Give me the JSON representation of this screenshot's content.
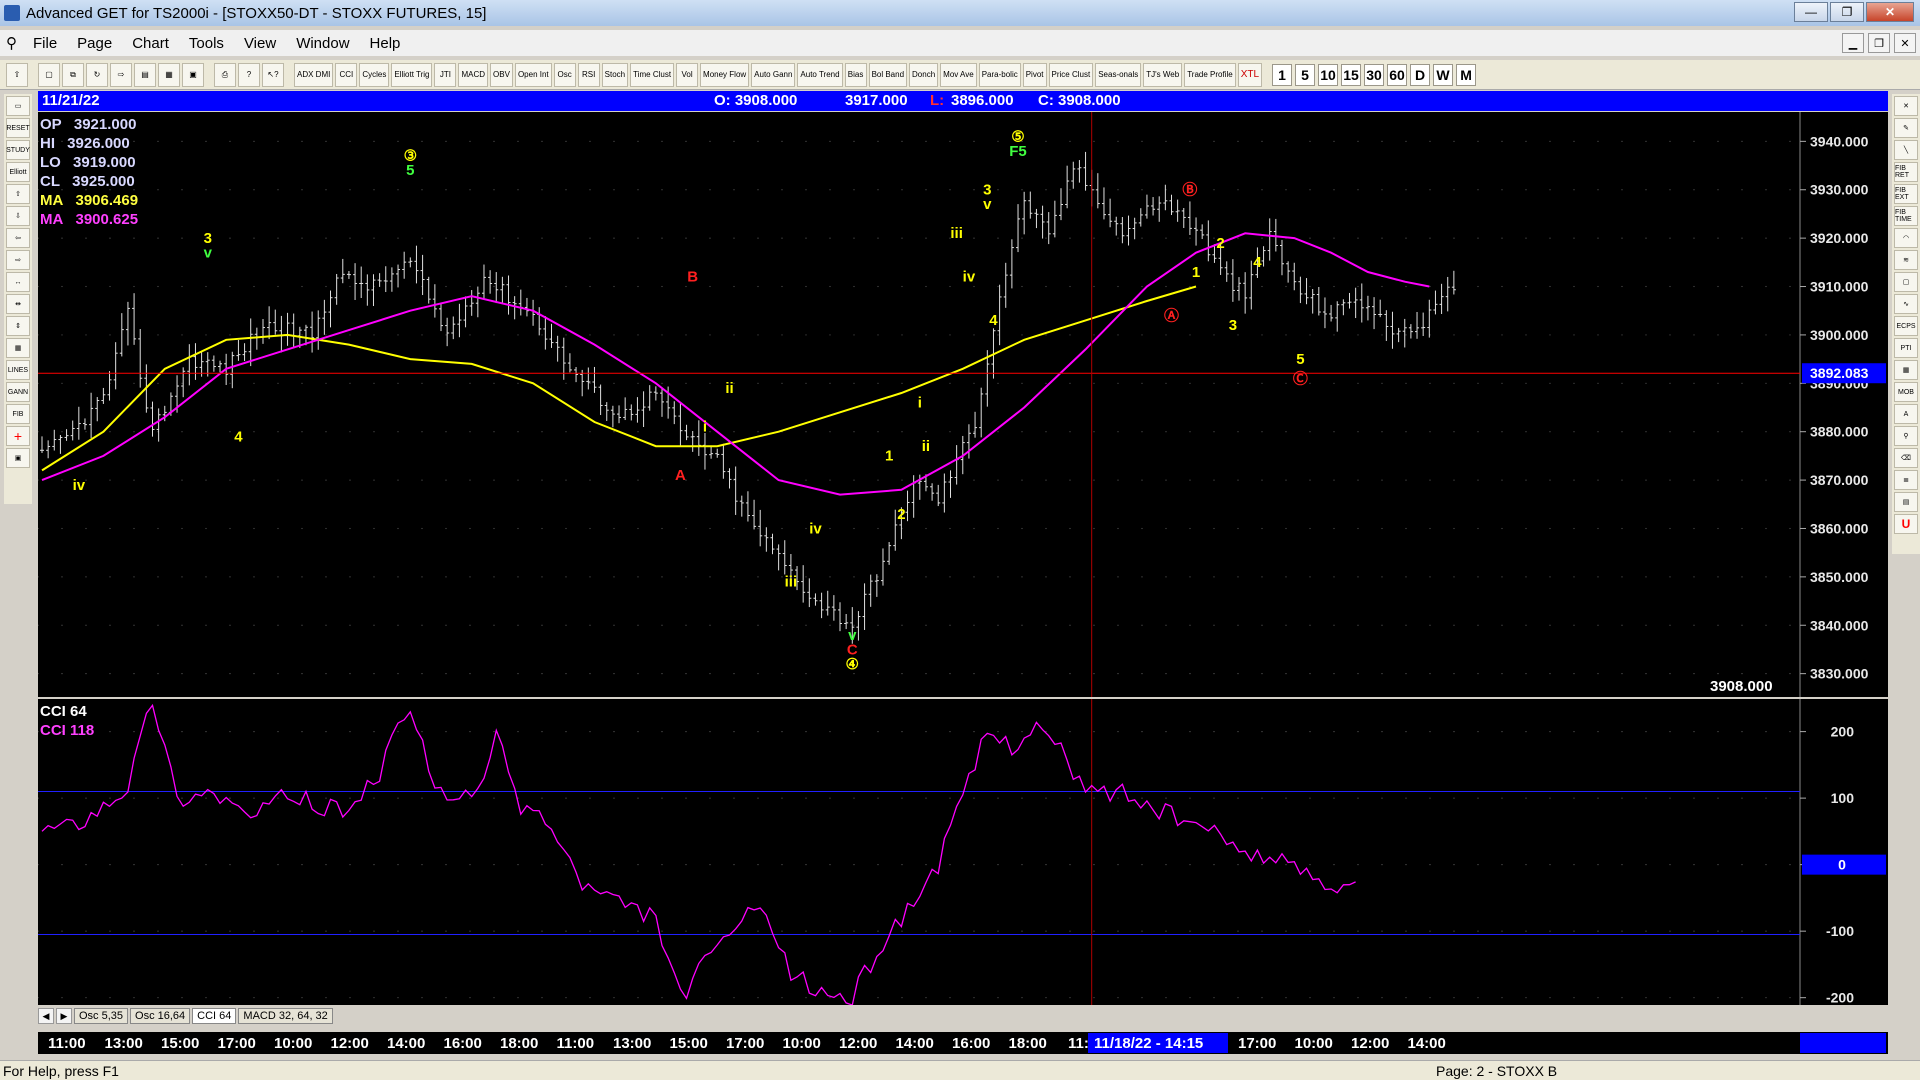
{
  "window": {
    "title": "Advanced GET for TS2000i - [STOXX50-DT - STOXX FUTURES, 15]",
    "minimize_glyph": "—",
    "maximize_glyph": "❐",
    "close_glyph": "✕"
  },
  "menu": [
    "File",
    "Page",
    "Chart",
    "Tools",
    "View",
    "Window",
    "Help"
  ],
  "doc_buttons": [
    "▁",
    "❐",
    "✕"
  ],
  "toolbar": {
    "studies": [
      "ADX DMI",
      "CCI",
      "Cycles",
      "Elliott Trig",
      "JTI",
      "MACD",
      "OBV",
      "Open Int",
      "Osc",
      "RSI",
      "Stoch",
      "Time Clust",
      "Vol",
      "Money Flow",
      "Auto Gann",
      "Auto Trend",
      "Bias",
      "Bol Band",
      "Donch",
      "Mov Ave",
      "Para-bolic",
      "Pivot",
      "Price Clust",
      "Seas-onals",
      "TJ's Web",
      "Trade Profile",
      "XTL"
    ],
    "periods": [
      "1",
      "5",
      "10",
      "15",
      "30",
      "60",
      "D",
      "W",
      "M"
    ]
  },
  "left_tools": [
    "RESET",
    "STUDY",
    "Elliott",
    "LINES",
    "GANN",
    "FIB"
  ],
  "right_tools": [
    "FIB RET",
    "FIB EXT",
    "FIB TIME",
    "ECPS",
    "PTI",
    "MOB"
  ],
  "infobar": {
    "date": "11/21/22",
    "open": "O: 3908.000",
    "high": "3917.000",
    "low_label": "L:",
    "low": "3896.000",
    "close": "C: 3908.000"
  },
  "readouts": [
    {
      "label": "OP",
      "value": "3921.000",
      "color": "#d8d8ff"
    },
    {
      "label": "HI",
      "value": "3926.000",
      "color": "#d8d8ff"
    },
    {
      "label": "LO",
      "value": "3919.000",
      "color": "#d8d8ff"
    },
    {
      "label": "CL",
      "value": "3925.000",
      "color": "#d8d8ff"
    },
    {
      "label": "MA",
      "value": "3906.469",
      "color": "#ffff40"
    },
    {
      "label": "MA",
      "value": "3900.625",
      "color": "#ff40ff"
    }
  ],
  "cci_readouts": [
    {
      "label": "CCI 64",
      "value": "",
      "color": "#ffffff"
    },
    {
      "label": "CCI",
      "value": "118",
      "color": "#ff40ff"
    }
  ],
  "price_cursor_label": "3892.083",
  "last_price_label": "3908.000",
  "cci_zero_label": "0",
  "time_cursor_label": "11/18/22 - 14:15",
  "tabs": [
    "Osc 5,35",
    "Osc 16,64",
    "CCI 64",
    "MACD 32, 64, 32"
  ],
  "active_tab": "CCI 64",
  "status": {
    "left": "For Help, press F1",
    "right": "Page: 2 - STOXX B"
  },
  "colors": {
    "bars": "#e0e0e0",
    "ma_fast": "#ffff00",
    "ma_slow": "#ff00ff",
    "cursor": "#ff0000",
    "wave_yellow": "#ffff00",
    "wave_red": "#ff2020",
    "wave_green": "#40ff40",
    "cci_band": "#2020ff"
  },
  "chart_data": [
    {
      "type": "candlestick",
      "title": "STOXX50-DT - STOXX FUTURES, 15",
      "ylim": [
        3826,
        3944
      ],
      "y_ticks": [
        3830,
        3840,
        3850,
        3860,
        3870,
        3880,
        3890,
        3900,
        3910,
        3920,
        3930,
        3940
      ],
      "y_tick_labels": [
        "3830.000",
        "3840.000",
        "3850.000",
        "3860.000",
        "3870.000",
        "3880.000",
        "3890.000",
        "3900.000",
        "3910.000",
        "3920.000",
        "3930.000",
        "3940.000"
      ],
      "x_labels": [
        "11:00",
        "13:00",
        "15:00",
        "17:00",
        "10:00",
        "12:00",
        "14:00",
        "16:00",
        "18:00",
        "11:00",
        "13:00",
        "15:00",
        "17:00",
        "10:00",
        "12:00",
        "14:00",
        "16:00",
        "18:00",
        "11:",
        "17:00",
        "10:00",
        "12:00",
        "14:00"
      ],
      "price_path": [
        [
          0,
          3875
        ],
        [
          5,
          3880
        ],
        [
          10,
          3887
        ],
        [
          14,
          3904
        ],
        [
          18,
          3880
        ],
        [
          24,
          3895
        ],
        [
          30,
          3893
        ],
        [
          36,
          3902
        ],
        [
          44,
          3900
        ],
        [
          48,
          3912
        ],
        [
          54,
          3910
        ],
        [
          60,
          3915
        ],
        [
          66,
          3900
        ],
        [
          72,
          3912
        ],
        [
          80,
          3904
        ],
        [
          86,
          3893
        ],
        [
          94,
          3883
        ],
        [
          100,
          3888
        ],
        [
          104,
          3880
        ],
        [
          110,
          3874
        ],
        [
          115,
          3862
        ],
        [
          120,
          3854
        ],
        [
          126,
          3845
        ],
        [
          132,
          3840
        ],
        [
          138,
          3856
        ],
        [
          142,
          3870
        ],
        [
          146,
          3866
        ],
        [
          152,
          3882
        ],
        [
          156,
          3908
        ],
        [
          160,
          3928
        ],
        [
          164,
          3920
        ],
        [
          168,
          3935
        ],
        [
          172,
          3928
        ],
        [
          176,
          3921
        ],
        [
          182,
          3928
        ],
        [
          188,
          3922
        ],
        [
          192,
          3913
        ],
        [
          196,
          3908
        ],
        [
          200,
          3921
        ],
        [
          204,
          3910
        ],
        [
          210,
          3904
        ],
        [
          214,
          3908
        ],
        [
          218,
          3903
        ],
        [
          222,
          3900
        ],
        [
          226,
          3904
        ],
        [
          228,
          3907
        ],
        [
          230,
          3910
        ]
      ],
      "ma_fast": [
        [
          0,
          3872
        ],
        [
          10,
          3880
        ],
        [
          20,
          3893
        ],
        [
          30,
          3899
        ],
        [
          40,
          3900
        ],
        [
          50,
          3898
        ],
        [
          60,
          3895
        ],
        [
          70,
          3894
        ],
        [
          80,
          3890
        ],
        [
          90,
          3882
        ],
        [
          100,
          3877
        ],
        [
          110,
          3877
        ],
        [
          120,
          3880
        ],
        [
          130,
          3884
        ],
        [
          140,
          3888
        ],
        [
          150,
          3893
        ],
        [
          160,
          3899
        ],
        [
          170,
          3903
        ],
        [
          180,
          3907
        ],
        [
          188,
          3910
        ]
      ],
      "ma_slow": [
        [
          0,
          3870
        ],
        [
          10,
          3875
        ],
        [
          20,
          3883
        ],
        [
          30,
          3893
        ],
        [
          40,
          3897
        ],
        [
          50,
          3901
        ],
        [
          60,
          3905
        ],
        [
          70,
          3908
        ],
        [
          80,
          3905
        ],
        [
          90,
          3898
        ],
        [
          100,
          3890
        ],
        [
          110,
          3880
        ],
        [
          120,
          3870
        ],
        [
          130,
          3867
        ],
        [
          140,
          3868
        ],
        [
          150,
          3875
        ],
        [
          160,
          3885
        ],
        [
          170,
          3897
        ],
        [
          180,
          3910
        ],
        [
          188,
          3917
        ],
        [
          196,
          3921
        ],
        [
          204,
          3920
        ],
        [
          210,
          3917
        ],
        [
          216,
          3913
        ],
        [
          222,
          3911
        ],
        [
          226,
          3910
        ]
      ],
      "wave_labels": [
        {
          "text": "iv",
          "i": 6,
          "y": 3868,
          "color": "#ffff00"
        },
        {
          "text": "3",
          "i": 27,
          "y": 3919,
          "color": "#ffff00"
        },
        {
          "text": "v",
          "i": 27,
          "y": 3916,
          "color": "#40ff40"
        },
        {
          "text": "4",
          "i": 32,
          "y": 3878,
          "color": "#ffff00"
        },
        {
          "text": "③",
          "i": 60,
          "y": 3936,
          "color": "#ffff00"
        },
        {
          "text": "5",
          "i": 60,
          "y": 3933,
          "color": "#40ff40"
        },
        {
          "text": "B",
          "i": 106,
          "y": 3911,
          "color": "#ff2020"
        },
        {
          "text": "A",
          "i": 104,
          "y": 3870,
          "color": "#ff2020"
        },
        {
          "text": "ii",
          "i": 112,
          "y": 3888,
          "color": "#ffff00"
        },
        {
          "text": "i",
          "i": 108,
          "y": 3880,
          "color": "#ffff00"
        },
        {
          "text": "iv",
          "i": 126,
          "y": 3859,
          "color": "#ffff00"
        },
        {
          "text": "iii",
          "i": 122,
          "y": 3848,
          "color": "#ffff00"
        },
        {
          "text": "v",
          "i": 132,
          "y": 3837,
          "color": "#40ff40"
        },
        {
          "text": "C",
          "i": 132,
          "y": 3834,
          "color": "#ff2020"
        },
        {
          "text": "④",
          "i": 132,
          "y": 3831,
          "color": "#ffff00"
        },
        {
          "text": "1",
          "i": 138,
          "y": 3874,
          "color": "#ffff00"
        },
        {
          "text": "2",
          "i": 140,
          "y": 3862,
          "color": "#ffff00"
        },
        {
          "text": "i",
          "i": 143,
          "y": 3885,
          "color": "#ffff00"
        },
        {
          "text": "ii",
          "i": 144,
          "y": 3876,
          "color": "#ffff00"
        },
        {
          "text": "iii",
          "i": 149,
          "y": 3920,
          "color": "#ffff00"
        },
        {
          "text": "iv",
          "i": 151,
          "y": 3911,
          "color": "#ffff00"
        },
        {
          "text": "3",
          "i": 154,
          "y": 3929,
          "color": "#ffff00"
        },
        {
          "text": "v",
          "i": 154,
          "y": 3926,
          "color": "#ffff00"
        },
        {
          "text": "4",
          "i": 155,
          "y": 3902,
          "color": "#ffff00"
        },
        {
          "text": "⑤",
          "i": 159,
          "y": 3940,
          "color": "#ffff00"
        },
        {
          "text": "F5",
          "i": 159,
          "y": 3937,
          "color": "#40ff40"
        },
        {
          "text": "Ⓑ",
          "i": 187,
          "y": 3929,
          "color": "#ff2020"
        },
        {
          "text": "1",
          "i": 188,
          "y": 3912,
          "color": "#ffff00"
        },
        {
          "text": "2",
          "i": 192,
          "y": 3918,
          "color": "#ffff00"
        },
        {
          "text": "Ⓐ",
          "i": 184,
          "y": 3903,
          "color": "#ff2020"
        },
        {
          "text": "3",
          "i": 194,
          "y": 3901,
          "color": "#ffff00"
        },
        {
          "text": "4",
          "i": 198,
          "y": 3914,
          "color": "#ffff00"
        },
        {
          "text": "5",
          "i": 205,
          "y": 3894,
          "color": "#ffff00"
        },
        {
          "text": "Ⓒ",
          "i": 205,
          "y": 3890,
          "color": "#ff2020"
        }
      ],
      "price_cursor": 3892.083,
      "time_cursor_index": 171
    },
    {
      "type": "line",
      "title": "CCI 64",
      "ylim": [
        -205,
        240
      ],
      "y_ticks": [
        200,
        100,
        0,
        -100,
        -200
      ],
      "y_tick_labels": [
        "200",
        "100",
        "0",
        "-100",
        "-200"
      ],
      "bands": [
        110,
        -105
      ],
      "series": [
        {
          "name": "CCI",
          "points": [
            [
              0,
              55
            ],
            [
              5,
              60
            ],
            [
              10,
              90
            ],
            [
              14,
              120
            ],
            [
              18,
              250
            ],
            [
              22,
              100
            ],
            [
              28,
              110
            ],
            [
              34,
              70
            ],
            [
              40,
              105
            ],
            [
              48,
              80
            ],
            [
              54,
              120
            ],
            [
              60,
              240
            ],
            [
              64,
              110
            ],
            [
              70,
              95
            ],
            [
              74,
              190
            ],
            [
              78,
              90
            ],
            [
              82,
              70
            ],
            [
              88,
              -30
            ],
            [
              94,
              -60
            ],
            [
              100,
              -80
            ],
            [
              104,
              -200
            ],
            [
              108,
              -150
            ],
            [
              112,
              -100
            ],
            [
              116,
              -70
            ],
            [
              118,
              -90
            ],
            [
              122,
              -160
            ],
            [
              126,
              -190
            ],
            [
              132,
              -200
            ],
            [
              136,
              -130
            ],
            [
              140,
              -80
            ],
            [
              146,
              0
            ],
            [
              150,
              100
            ],
            [
              154,
              200
            ],
            [
              158,
              180
            ],
            [
              162,
              210
            ],
            [
              166,
              170
            ],
            [
              170,
              110
            ],
            [
              176,
              110
            ],
            [
              182,
              80
            ],
            [
              188,
              60
            ],
            [
              194,
              30
            ],
            [
              200,
              10
            ],
            [
              206,
              -10
            ],
            [
              210,
              -30
            ],
            [
              214,
              -20
            ]
          ]
        }
      ]
    }
  ]
}
